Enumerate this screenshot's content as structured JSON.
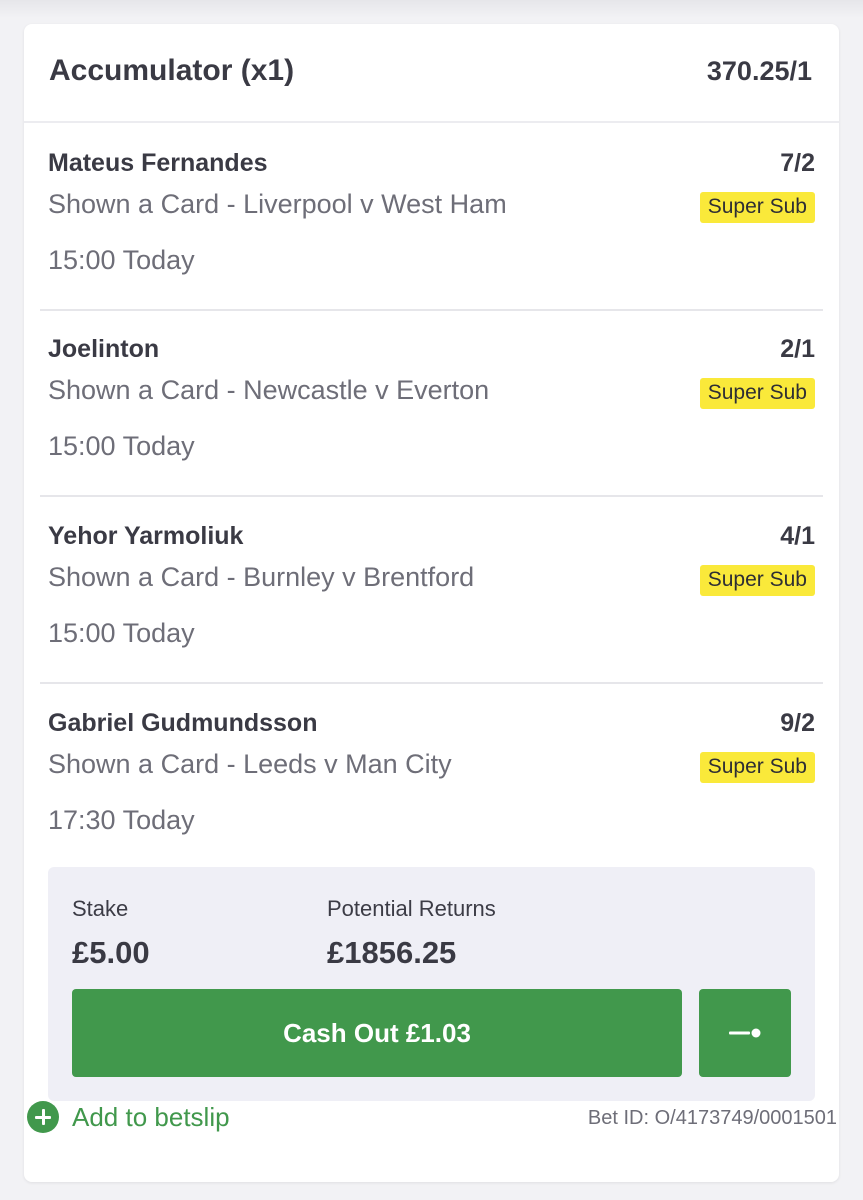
{
  "accumulator": {
    "title": "Accumulator (x1)",
    "odds": "370.25/1"
  },
  "selections": [
    {
      "name": "Mateus Fernandes",
      "odds": "7/2",
      "market": "Shown a Card - Liverpool v West Ham",
      "badge": "Super Sub",
      "time": "15:00 Today"
    },
    {
      "name": "Joelinton",
      "odds": "2/1",
      "market": "Shown a Card - Newcastle v Everton",
      "badge": "Super Sub",
      "time": "15:00 Today"
    },
    {
      "name": "Yehor Yarmoliuk",
      "odds": "4/1",
      "market": "Shown a Card - Burnley v Brentford",
      "badge": "Super Sub",
      "time": "15:00 Today"
    },
    {
      "name": "Gabriel Gudmundsson",
      "odds": "9/2",
      "market": "Shown a Card - Leeds v Man City",
      "badge": "Super Sub",
      "time": "17:30 Today"
    }
  ],
  "stake": {
    "stake_label": "Stake",
    "stake_value": "£5.00",
    "returns_label": "Potential Returns",
    "returns_value": "£1856.25",
    "cashout_label": "Cash Out £1.03",
    "partial_cashout_icon": "partial-cashout-slider-icon"
  },
  "footer": {
    "add_label": "Add to betslip",
    "add_icon": "plus-circle-icon",
    "bet_id": "Bet ID: O/4173749/0001501"
  },
  "colors": {
    "accent_green": "#41984c",
    "badge_yellow": "#fae93a",
    "stake_panel": "#efeff6"
  }
}
